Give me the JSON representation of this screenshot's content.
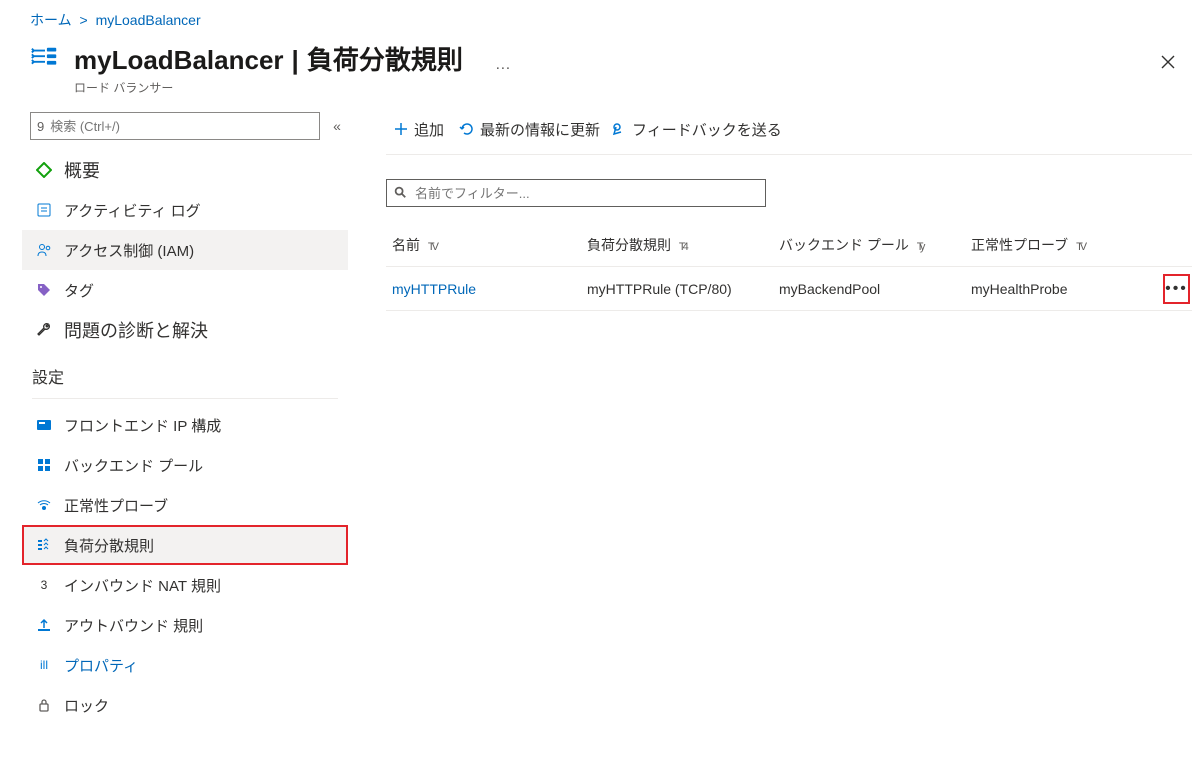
{
  "breadcrumb": {
    "home": "ホーム",
    "resource": "myLoadBalancer"
  },
  "header": {
    "resource_name": "myLoadBalancer",
    "subtitle": "負荷分散規則",
    "resource_type": "ロード バランサー",
    "more": "…",
    "close": "×"
  },
  "sidebar": {
    "search_placeholder": "検索 (Ctrl+/)",
    "search_badge": "9",
    "collapse": "«",
    "items": [
      {
        "id": "overview",
        "icon": "diamond",
        "label": "概要",
        "big": true
      },
      {
        "id": "activity",
        "icon": "log",
        "label": "アクティビティ ログ"
      },
      {
        "id": "iam",
        "icon": "people",
        "label": "アクセス制御 (IAM)"
      },
      {
        "id": "tags",
        "icon": "tag",
        "label": "タグ"
      },
      {
        "id": "diagnose",
        "icon": "wrench",
        "label": "問題の診断と解決",
        "big": true
      }
    ],
    "section_settings": "設定",
    "settings": [
      {
        "id": "frontend",
        "icon": "frontend",
        "label": "フロントエンド IP 構成"
      },
      {
        "id": "backend",
        "icon": "backend",
        "label": "バックエンド プール"
      },
      {
        "id": "probe",
        "icon": "probe",
        "label": "正常性プローブ"
      },
      {
        "id": "lbrules",
        "icon": "lbrules",
        "label": "負荷分散規則"
      },
      {
        "id": "nat",
        "icon": "nat",
        "label": "インバウンド NAT 規則",
        "prefix": "3"
      },
      {
        "id": "outbound",
        "icon": "outbound",
        "label": "アウトバウンド 規則"
      },
      {
        "id": "props",
        "icon": "props",
        "label": "プロパティ",
        "prefix": "ill"
      },
      {
        "id": "locks",
        "icon": "lock",
        "label": "ロック"
      }
    ]
  },
  "toolbar": {
    "add": "追加",
    "refresh": "最新の情報に更新",
    "feedback": "フィードバックを送る"
  },
  "filter": {
    "placeholder": "名前でフィルター..."
  },
  "columns": {
    "name": "名前",
    "rule": "負荷分散規則",
    "pool": "バックエンド プール",
    "probe": "正常性プローブ"
  },
  "column_suffix": {
    "name": "TV",
    "rule": "T4",
    "pool": "Ty",
    "probe": "TV"
  },
  "rows": [
    {
      "name": "myHTTPRule",
      "rule": "myHTTPRule (TCP/80)",
      "pool": "myBackendPool",
      "probe": "myHealthProbe"
    }
  ]
}
